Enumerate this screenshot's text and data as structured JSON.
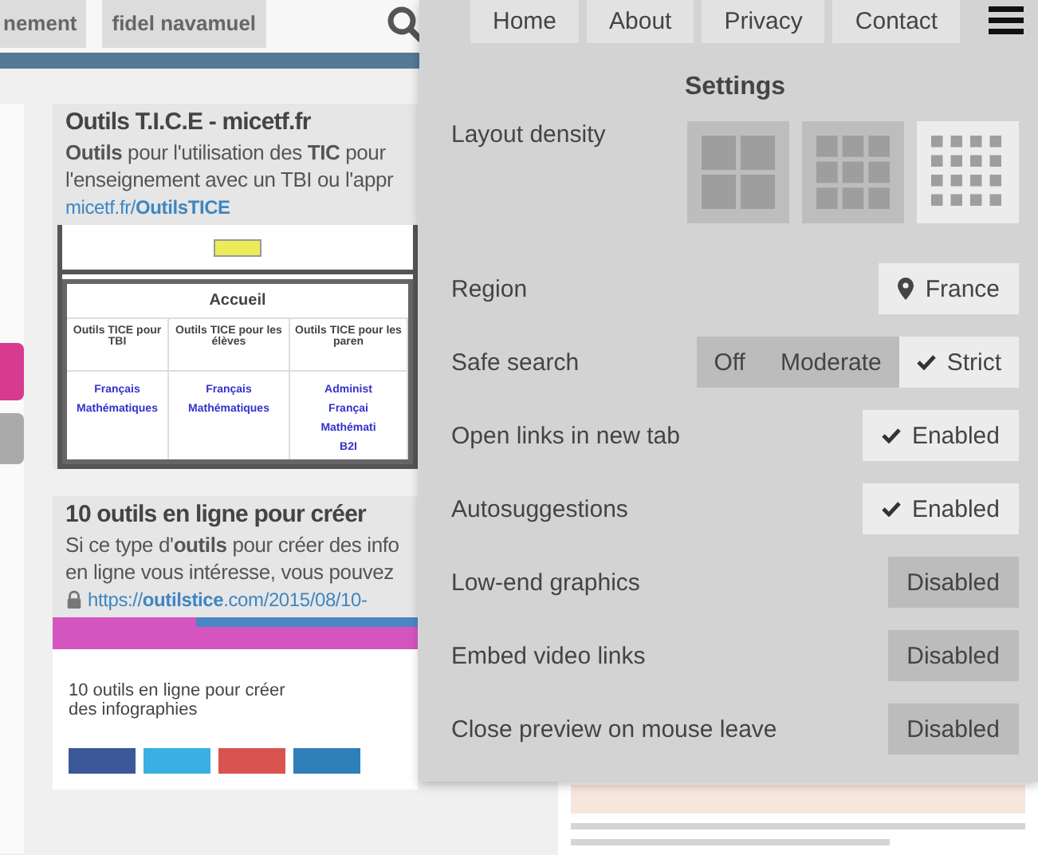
{
  "background": {
    "tabs": [
      "nement",
      "fidel navamuel"
    ],
    "cards": [
      {
        "title": "Outils T.I.C.E - micetf.fr",
        "description": "**Outils** pour l'utilisation des **TIC** pour l'enseignement avec un TBI ou l'appr",
        "url": "micetf.fr/**OutilsTICE**",
        "secure": false,
        "preview": {
          "kind": "table",
          "heading": "Accueil",
          "columns": [
            "Outils TICE pour TBI",
            "Outils TICE pour les élèves",
            "Outils TICE pour les paren"
          ],
          "links": [
            [
              "Français",
              "Mathématiques"
            ],
            [
              "Français",
              "Mathématiques"
            ],
            [
              "Administ",
              "Françai",
              "Mathémati",
              "B2I"
            ]
          ]
        }
      },
      {
        "title": "10 outils en ligne pour créer",
        "description": "Si ce type d'**outils** pour créer des info en ligne vous intéresse, vous pouvez",
        "url": "https://**outilstice**.com/2015/08/10-",
        "secure": true,
        "preview": {
          "kind": "article",
          "heading": "10 outils en ligne pour créer des infographies"
        }
      }
    ]
  },
  "panel": {
    "nav": [
      "Home",
      "About",
      "Privacy",
      "Contact"
    ],
    "title": "Settings",
    "settings": [
      {
        "kind": "density",
        "label": "Layout density",
        "options": [
          {
            "selected": false
          },
          {
            "selected": false
          },
          {
            "selected": true
          }
        ]
      },
      {
        "kind": "location",
        "label": "Region",
        "value": "France"
      },
      {
        "kind": "segmented",
        "label": "Safe search",
        "options": [
          {
            "label": "Off",
            "selected": false
          },
          {
            "label": "Moderate",
            "selected": false
          },
          {
            "label": "Strict",
            "selected": true
          }
        ]
      },
      {
        "kind": "toggle",
        "label": "Open links in new tab",
        "value": "Enabled",
        "on": true
      },
      {
        "kind": "toggle",
        "label": "Autosuggestions",
        "value": "Enabled",
        "on": true
      },
      {
        "kind": "toggle",
        "label": "Low-end graphics",
        "value": "Disabled",
        "on": false
      },
      {
        "kind": "toggle",
        "label": "Embed video links",
        "value": "Disabled",
        "on": false
      },
      {
        "kind": "toggle",
        "label": "Close preview on mouse leave",
        "value": "Disabled",
        "on": false
      }
    ]
  }
}
